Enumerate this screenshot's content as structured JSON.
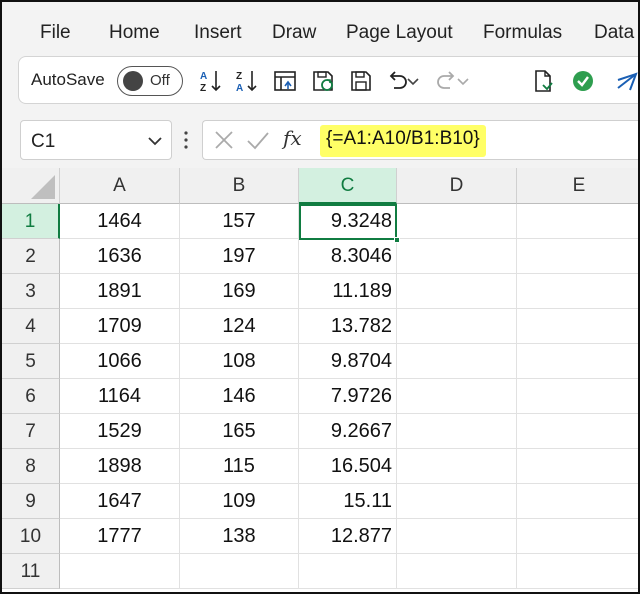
{
  "menu": {
    "items": [
      "File",
      "Home",
      "Insert",
      "Draw",
      "Page Layout",
      "Formulas",
      "Data"
    ]
  },
  "toolbar": {
    "autosave_label": "AutoSave",
    "toggle_state": "Off",
    "icons": [
      "sort-ascending-icon",
      "sort-descending-icon",
      "pivot-table-icon",
      "refresh-save-icon",
      "save-icon",
      "undo-icon",
      "redo-icon",
      "document-icon",
      "check-circle-icon",
      "send-icon"
    ]
  },
  "formula_bar": {
    "name_box": "C1",
    "fx_label": "fx",
    "formula": "{=A1:A10/B1:B10}",
    "highlight_color": "#ffff66"
  },
  "grid": {
    "columns": [
      "A",
      "B",
      "C",
      "D",
      "E"
    ],
    "selected_column": "C",
    "selected_row": "1",
    "rows": [
      {
        "num": "1",
        "A": "1464",
        "B": "157",
        "C": "9.3248",
        "D": "",
        "E": ""
      },
      {
        "num": "2",
        "A": "1636",
        "B": "197",
        "C": "8.3046",
        "D": "",
        "E": ""
      },
      {
        "num": "3",
        "A": "1891",
        "B": "169",
        "C": "11.189",
        "D": "",
        "E": ""
      },
      {
        "num": "4",
        "A": "1709",
        "B": "124",
        "C": "13.782",
        "D": "",
        "E": ""
      },
      {
        "num": "5",
        "A": "1066",
        "B": "108",
        "C": "9.8704",
        "D": "",
        "E": ""
      },
      {
        "num": "6",
        "A": "1164",
        "B": "146",
        "C": "7.9726",
        "D": "",
        "E": ""
      },
      {
        "num": "7",
        "A": "1529",
        "B": "165",
        "C": "9.2667",
        "D": "",
        "E": ""
      },
      {
        "num": "8",
        "A": "1898",
        "B": "115",
        "C": "16.504",
        "D": "",
        "E": ""
      },
      {
        "num": "9",
        "A": "1647",
        "B": "109",
        "C": "15.11",
        "D": "",
        "E": ""
      },
      {
        "num": "10",
        "A": "1777",
        "B": "138",
        "C": "12.877",
        "D": "",
        "E": ""
      },
      {
        "num": "11",
        "A": "",
        "B": "",
        "C": "",
        "D": "",
        "E": ""
      }
    ]
  },
  "colors": {
    "accent_green": "#107c41",
    "header_bg": "#f0f0f0",
    "selected_header_bg": "#d3f0e0"
  }
}
